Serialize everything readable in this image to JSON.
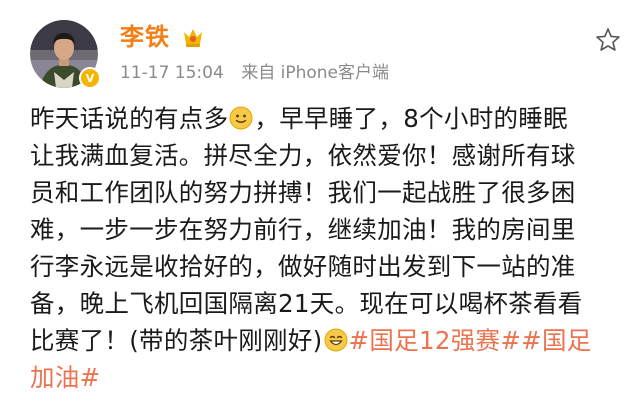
{
  "post": {
    "user": {
      "name": "李铁",
      "verified": true,
      "avatar_icon": "avatar-photo",
      "badge_icon": "vip-gold-icon"
    },
    "meta": {
      "time": "11-17 15:04",
      "source": "来自 iPhone客户端"
    },
    "favorite_icon": "star-outline-icon",
    "content": {
      "line1_a": "昨天话说的有点多",
      "line1_b": "，早早睡了，8个小时的睡眠",
      "line2": "让我满血复活。拼尽全力，依然爱你！感谢所有球",
      "line3": "员和工作团队的努力拼搏！我们一起战胜了很多困",
      "line4": "难，一步一步在努力前行，继续加油！我的房间里",
      "line5": "行李永远是收拾好的，做好随时出发到下一站的准",
      "line6": "备，晚上飞机回国隔离21天。现在可以喝杯茶看看",
      "line7_a": "比赛了！(带的茶叶刚刚好)",
      "hashtag1": "#国足12强赛#",
      "hashtag2_a": "#国足",
      "hashtag2_b": "加油#"
    },
    "emoji_names": [
      "smile-emoji",
      "grin-emoji"
    ],
    "colors": {
      "username": "#f57f17",
      "hashtag": "#eb7350",
      "meta": "#8a8a8a",
      "text": "#1a1a1a"
    }
  }
}
